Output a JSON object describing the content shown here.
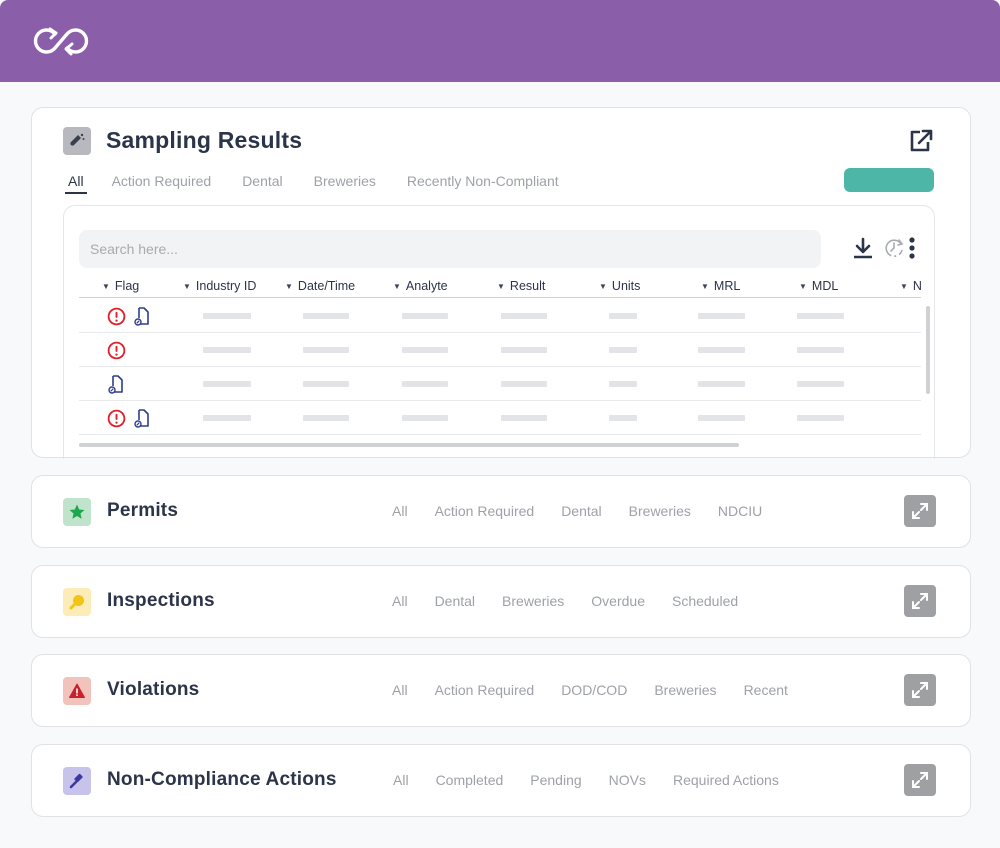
{
  "header": {
    "logo_icon": "infinity-sync-logo",
    "brand_color": "#8a5ea9"
  },
  "sampling": {
    "title": "Sampling Results",
    "icon": "test-tube-icon",
    "tabs": [
      {
        "label": "All",
        "active": true
      },
      {
        "label": "Action Required"
      },
      {
        "label": "Dental"
      },
      {
        "label": "Breweries"
      },
      {
        "label": "Recently Non-Compliant"
      }
    ],
    "action_button_color": "#4db6a7",
    "search": {
      "placeholder": "Search here...",
      "value": ""
    },
    "toolbar": [
      "download-icon",
      "history-icon",
      "more-vertical-icon"
    ],
    "columns": [
      "Flag",
      "Industry ID",
      "Date/Time",
      "Analyte",
      "Result",
      "Units",
      "MRL",
      "MDL",
      "N"
    ],
    "rows": [
      {
        "flags": [
          "alert",
          "doc"
        ]
      },
      {
        "flags": [
          "alert"
        ]
      },
      {
        "flags": [
          "doc"
        ]
      },
      {
        "flags": [
          "alert",
          "doc"
        ]
      }
    ],
    "colors": {
      "alert": "#e0202a",
      "doc": "#2f3d8f"
    }
  },
  "sections": [
    {
      "id": "permits",
      "title": "Permits",
      "icon": "star-icon",
      "icon_bg": "#bfe4cb",
      "icon_fg": "#1ea64c",
      "tabs": [
        "All",
        "Action Required",
        "Dental",
        "Breweries",
        "NDCIU"
      ]
    },
    {
      "id": "inspections",
      "title": "Inspections",
      "icon": "magnifier-icon",
      "icon_bg": "#fbecb8",
      "icon_fg": "#f2c416",
      "tabs": [
        "All",
        "Dental",
        "Breweries",
        "Overdue",
        "Scheduled"
      ]
    },
    {
      "id": "violations",
      "title": "Violations",
      "icon": "warning-icon",
      "icon_bg": "#f2c3bd",
      "icon_fg": "#c8202c",
      "tabs": [
        "All",
        "Action Required",
        "DOD/COD",
        "Breweries",
        "Recent"
      ]
    },
    {
      "id": "non-compliance",
      "title": "Non-Compliance Actions",
      "icon": "gavel-icon",
      "icon_bg": "#c7c3ea",
      "icon_fg": "#3b3a9e",
      "tabs": [
        "All",
        "Completed",
        "Pending",
        "NOVs",
        "Required Actions"
      ]
    }
  ]
}
